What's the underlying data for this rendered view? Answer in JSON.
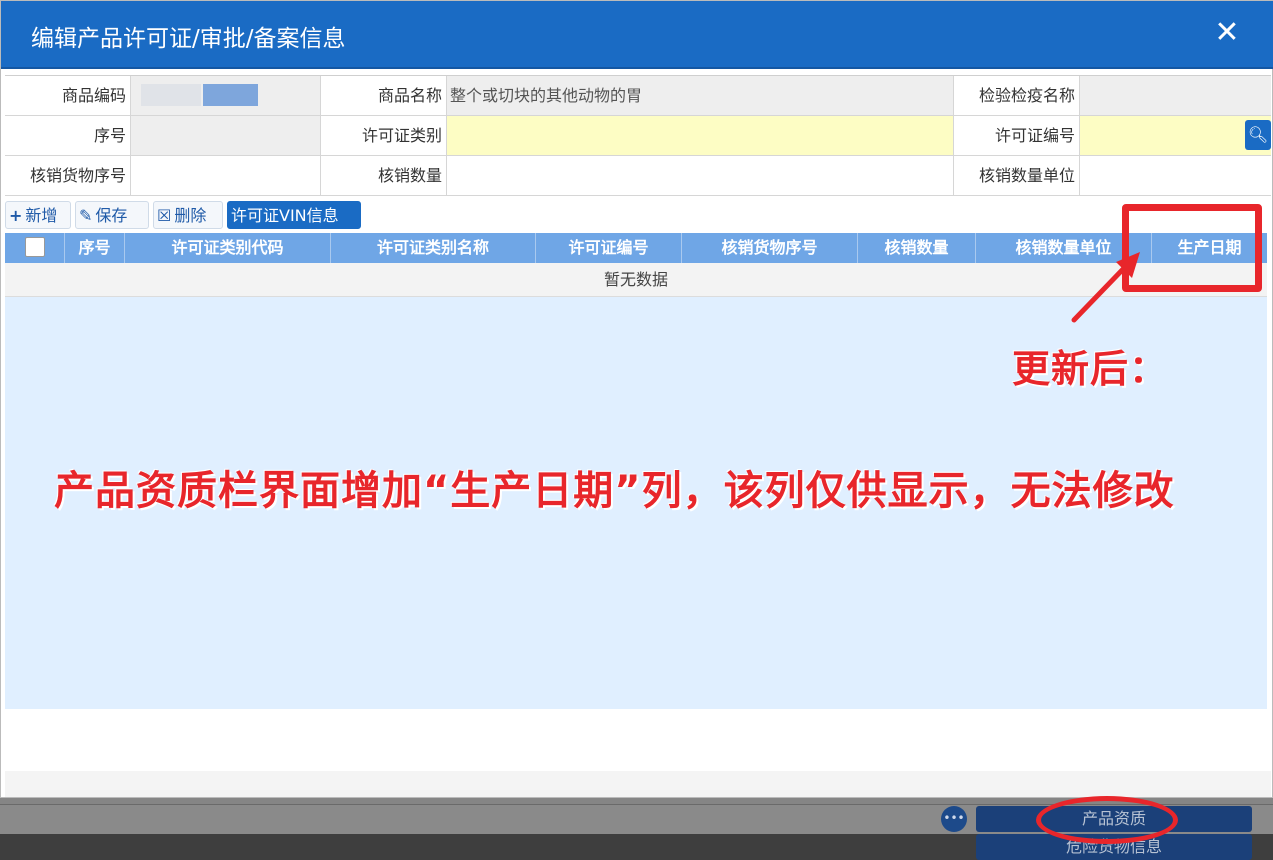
{
  "dialog": {
    "title": "编辑产品许可证/审批/备案信息",
    "close_icon": "close-icon",
    "close_glyph": "✕"
  },
  "form": {
    "row1": {
      "code_label": "商品编码",
      "name_label": "商品名称",
      "name_value": "整个或切块的其他动物的胃",
      "insp_label": "检验检疫名称"
    },
    "row2": {
      "seq_label": "序号",
      "lic_type_label": "许可证类别",
      "lic_no_label": "许可证编号",
      "search_icon": "search-icon"
    },
    "row3": {
      "writeoff_seq_label": "核销货物序号",
      "writeoff_qty_label": "核销数量",
      "writeoff_unit_label": "核销数量单位"
    }
  },
  "toolbar": {
    "add_icon": "plus-icon",
    "add_label": "新增",
    "save_icon": "edit-icon",
    "save_label": "保存",
    "delete_icon": "trash-icon",
    "delete_label": "删除",
    "vin_label": "许可证VIN信息"
  },
  "grid": {
    "columns": [
      "序号",
      "许可证类别代码",
      "许可证类别名称",
      "许可证编号",
      "核销货物序号",
      "核销数量",
      "核销数量单位",
      "生产日期"
    ],
    "empty_text": "暂无数据"
  },
  "annotations": {
    "updated_label": "更新后：",
    "main_note": "产品资质栏界面增加“生产日期”列，该列仅供显示，无法修改",
    "highlight_color": "#e8262b"
  },
  "background": {
    "more_icon": "ellipsis-icon",
    "btn_product_qualification": "产品资质",
    "btn_dangerous_goods": "危险货物信息"
  },
  "colors": {
    "title_bar": "#1a6bc4",
    "grid_header": "#6fa6e6",
    "required_field": "#fdfdc4"
  }
}
